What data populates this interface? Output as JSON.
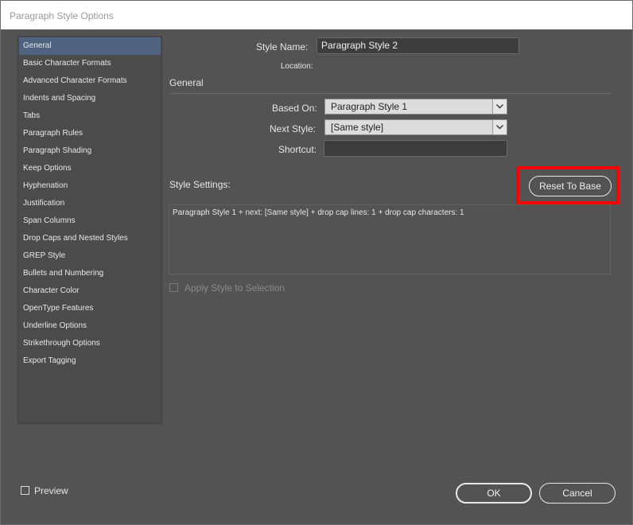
{
  "window": {
    "title": "Paragraph Style Options"
  },
  "sidebar": {
    "items": [
      {
        "label": "General",
        "selected": true
      },
      {
        "label": "Basic Character Formats"
      },
      {
        "label": "Advanced Character Formats"
      },
      {
        "label": "Indents and Spacing"
      },
      {
        "label": "Tabs"
      },
      {
        "label": "Paragraph Rules"
      },
      {
        "label": "Paragraph Shading"
      },
      {
        "label": "Keep Options"
      },
      {
        "label": "Hyphenation"
      },
      {
        "label": "Justification"
      },
      {
        "label": "Span Columns"
      },
      {
        "label": "Drop Caps and Nested Styles"
      },
      {
        "label": "GREP Style"
      },
      {
        "label": "Bullets and Numbering"
      },
      {
        "label": "Character Color"
      },
      {
        "label": "OpenType Features"
      },
      {
        "label": "Underline Options"
      },
      {
        "label": "Strikethrough Options"
      },
      {
        "label": "Export Tagging"
      }
    ]
  },
  "form": {
    "style_name_label": "Style Name:",
    "style_name_value": "Paragraph Style 2",
    "location_label": "Location:",
    "section_title": "General",
    "based_on_label": "Based On:",
    "based_on_value": "Paragraph Style 1",
    "next_style_label": "Next Style:",
    "next_style_value": "[Same style]",
    "shortcut_label": "Shortcut:",
    "shortcut_value": "",
    "style_settings_label": "Style Settings:",
    "reset_button": "Reset To Base",
    "style_settings_text": "Paragraph Style 1 + next: [Same style] + drop cap lines:  1 + drop cap characters:  1",
    "apply_style_label": "Apply Style to Selection",
    "apply_style_checked": false
  },
  "footer": {
    "preview_label": "Preview",
    "preview_checked": false,
    "ok_button": "OK",
    "cancel_button": "Cancel"
  },
  "colors": {
    "dialog_background": "#535353",
    "selected_item": "#4f6380",
    "highlight_annotation": "#ff0000"
  }
}
